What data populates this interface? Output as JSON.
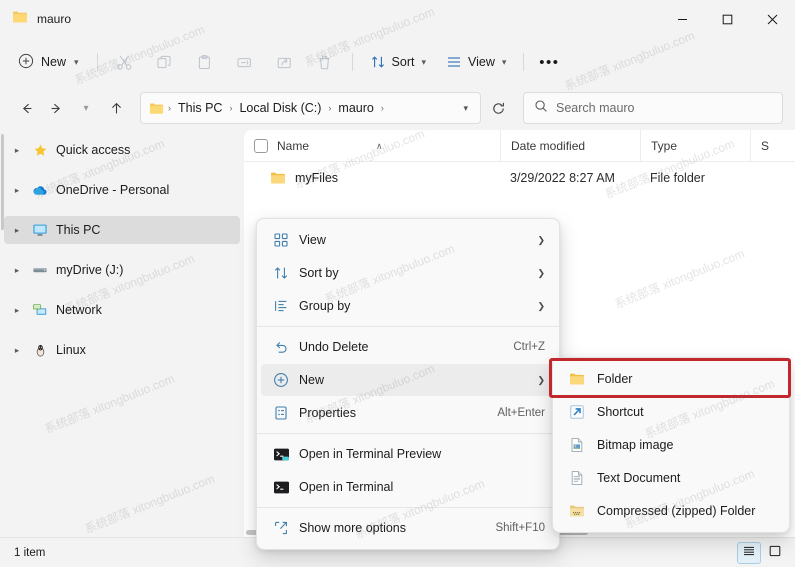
{
  "window": {
    "title": "mauro",
    "folder_icon": "folder-icon",
    "controls": {
      "minimize": "–",
      "maximize": "☐",
      "close": "✕"
    }
  },
  "toolbar": {
    "new_label": "New",
    "new_icon": "plus-circle-icon",
    "actions": [
      {
        "name": "cut",
        "icon": "scissors-icon"
      },
      {
        "name": "copy",
        "icon": "copy-icon"
      },
      {
        "name": "paste",
        "icon": "clipboard-icon"
      },
      {
        "name": "rename",
        "icon": "rename-icon"
      },
      {
        "name": "share",
        "icon": "share-icon"
      },
      {
        "name": "delete",
        "icon": "trash-icon"
      }
    ],
    "sort_label": "Sort",
    "sort_icon": "sort-arrows-icon",
    "view_label": "View",
    "view_icon": "lines-icon",
    "more_label": "•••"
  },
  "address": {
    "back_icon": "arrow-left-icon",
    "forward_icon": "arrow-right-icon",
    "recent_icon": "chevron-down-icon",
    "up_icon": "arrow-up-icon",
    "crumbs": [
      "This PC",
      "Local Disk (C:)",
      "mauro"
    ],
    "separator": "›",
    "refresh_icon": "refresh-icon"
  },
  "search": {
    "placeholder": "Search mauro",
    "icon": "search-icon"
  },
  "sidebar": {
    "items": [
      {
        "label": "Quick access",
        "icon": "star-icon",
        "selected": false
      },
      {
        "label": "OneDrive - Personal",
        "icon": "cloud-icon",
        "selected": false
      },
      {
        "label": "This PC",
        "icon": "monitor-icon",
        "selected": true
      },
      {
        "label": "myDrive (J:)",
        "icon": "drive-icon",
        "selected": false
      },
      {
        "label": "Network",
        "icon": "network-icon",
        "selected": false
      },
      {
        "label": "Linux",
        "icon": "penguin-icon",
        "selected": false
      }
    ]
  },
  "filelist": {
    "columns": [
      {
        "key": "name",
        "label": "Name"
      },
      {
        "key": "date",
        "label": "Date modified"
      },
      {
        "key": "type",
        "label": "Type"
      },
      {
        "key": "size",
        "label": "S"
      }
    ],
    "sort_caret": "∧",
    "rows": [
      {
        "name": "myFiles",
        "date": "3/29/2022 8:27 AM",
        "type": "File folder",
        "size": "",
        "icon": "folder-icon"
      }
    ]
  },
  "statusbar": {
    "count_label": "1 item",
    "views": [
      {
        "name": "details-view",
        "icon": "details-icon",
        "active": true
      },
      {
        "name": "large-icons-view",
        "icon": "large-icons-icon",
        "active": false
      }
    ]
  },
  "context_menu": {
    "items": [
      {
        "label": "View",
        "icon": "grid-icon",
        "accel": "",
        "arrow": true,
        "highlighted": false,
        "sep_after": false
      },
      {
        "label": "Sort by",
        "icon": "sort-arrows-icon",
        "accel": "",
        "arrow": true,
        "highlighted": false,
        "sep_after": false
      },
      {
        "label": "Group by",
        "icon": "group-icon",
        "accel": "",
        "arrow": true,
        "highlighted": false,
        "sep_after": true
      },
      {
        "label": "Undo Delete",
        "icon": "undo-icon",
        "accel": "Ctrl+Z",
        "arrow": false,
        "highlighted": false,
        "sep_after": false
      },
      {
        "label": "New",
        "icon": "plus-circle-icon",
        "accel": "",
        "arrow": true,
        "highlighted": true,
        "sep_after": false
      },
      {
        "label": "Properties",
        "icon": "properties-icon",
        "accel": "Alt+Enter",
        "arrow": false,
        "highlighted": false,
        "sep_after": true
      },
      {
        "label": "Open in Terminal Preview",
        "icon": "terminal-preview-icon",
        "accel": "",
        "arrow": false,
        "highlighted": false,
        "sep_after": false
      },
      {
        "label": "Open in Terminal",
        "icon": "terminal-icon",
        "accel": "",
        "arrow": false,
        "highlighted": false,
        "sep_after": true
      },
      {
        "label": "Show more options",
        "icon": "more-options-icon",
        "accel": "Shift+F10",
        "arrow": false,
        "highlighted": false,
        "sep_after": false
      }
    ]
  },
  "submenu": {
    "items": [
      {
        "label": "Folder",
        "icon": "folder-icon",
        "highlighted": true
      },
      {
        "label": "Shortcut",
        "icon": "shortcut-icon",
        "highlighted": false
      },
      {
        "label": "Bitmap image",
        "icon": "bitmap-icon",
        "highlighted": false
      },
      {
        "label": "Text Document",
        "icon": "text-document-icon",
        "highlighted": false
      },
      {
        "label": "Compressed (zipped) Folder",
        "icon": "zip-folder-icon",
        "highlighted": false
      }
    ]
  },
  "annotations": {
    "highlight_color": "#c0282d",
    "boxes": [
      {
        "name": "folder-annotation",
        "target": "Folder"
      }
    ]
  },
  "watermark": {
    "text": "系统部落 xitongbuluo.com"
  }
}
